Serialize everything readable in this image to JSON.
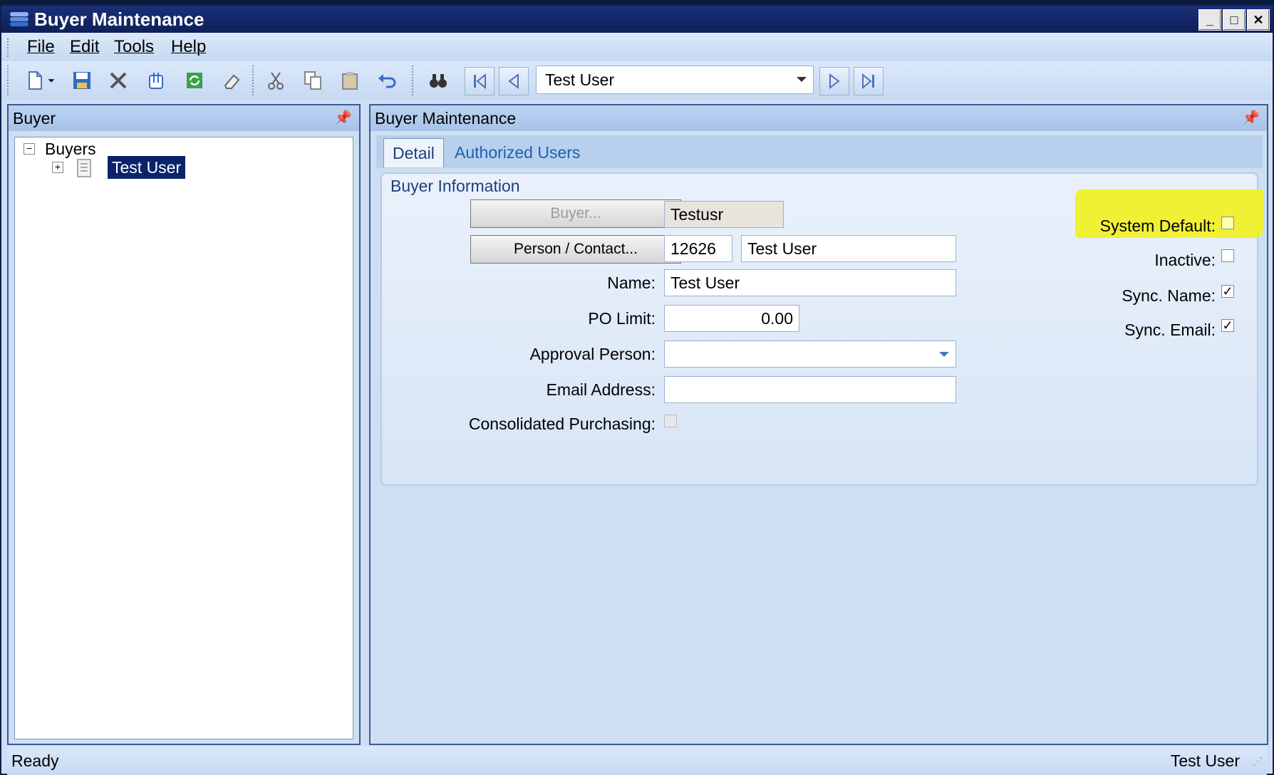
{
  "window": {
    "title": "Buyer Maintenance"
  },
  "menu": [
    "File",
    "Edit",
    "Tools",
    "Help"
  ],
  "toolbar": {
    "icons": [
      "new-doc-icon",
      "dropdown-arrow-icon",
      "save-icon",
      "delete-icon",
      "attach-icon",
      "refresh-icon",
      "erase-icon",
      "cut-icon",
      "copy-icon",
      "paste-icon",
      "undo-icon",
      "find-icon"
    ],
    "record_selector_value": "Test User",
    "nav_icons": [
      "first-record-icon",
      "previous-record-icon",
      "next-record-icon",
      "last-record-icon"
    ]
  },
  "left_pane": {
    "title": "Buyer",
    "tree": {
      "root_label": "Buyers",
      "child_label": "Test User"
    }
  },
  "right_pane": {
    "title": "Buyer Maintenance",
    "tabs": [
      "Detail",
      "Authorized Users"
    ],
    "active_tab": "Detail",
    "group_title": "Buyer Information",
    "buyer_button": "Buyer...",
    "buyer_code": "Testusr",
    "person_button": "Person / Contact...",
    "person_id": "12626",
    "person_name": "Test User",
    "name_label": "Name:",
    "name_value": "Test User",
    "po_limit_label": "PO Limit:",
    "po_limit_value": "0.00",
    "approval_label": "Approval Person:",
    "approval_value": "",
    "email_label": "Email Address:",
    "email_value": "",
    "consolidated_label": "Consolidated Purchasing:",
    "system_default_label": "System Default:",
    "inactive_label": "Inactive:",
    "sync_name_label": "Sync. Name:",
    "sync_email_label": "Sync. Email:",
    "checks": {
      "system_default": false,
      "inactive": false,
      "sync_name": true,
      "sync_email": true,
      "consolidated": false
    }
  },
  "status": {
    "left": "Ready",
    "right": "Test User"
  },
  "colors": {
    "title_bar": "#0f1f58",
    "selection": "#0a246a",
    "highlight": "#f0f02a"
  }
}
